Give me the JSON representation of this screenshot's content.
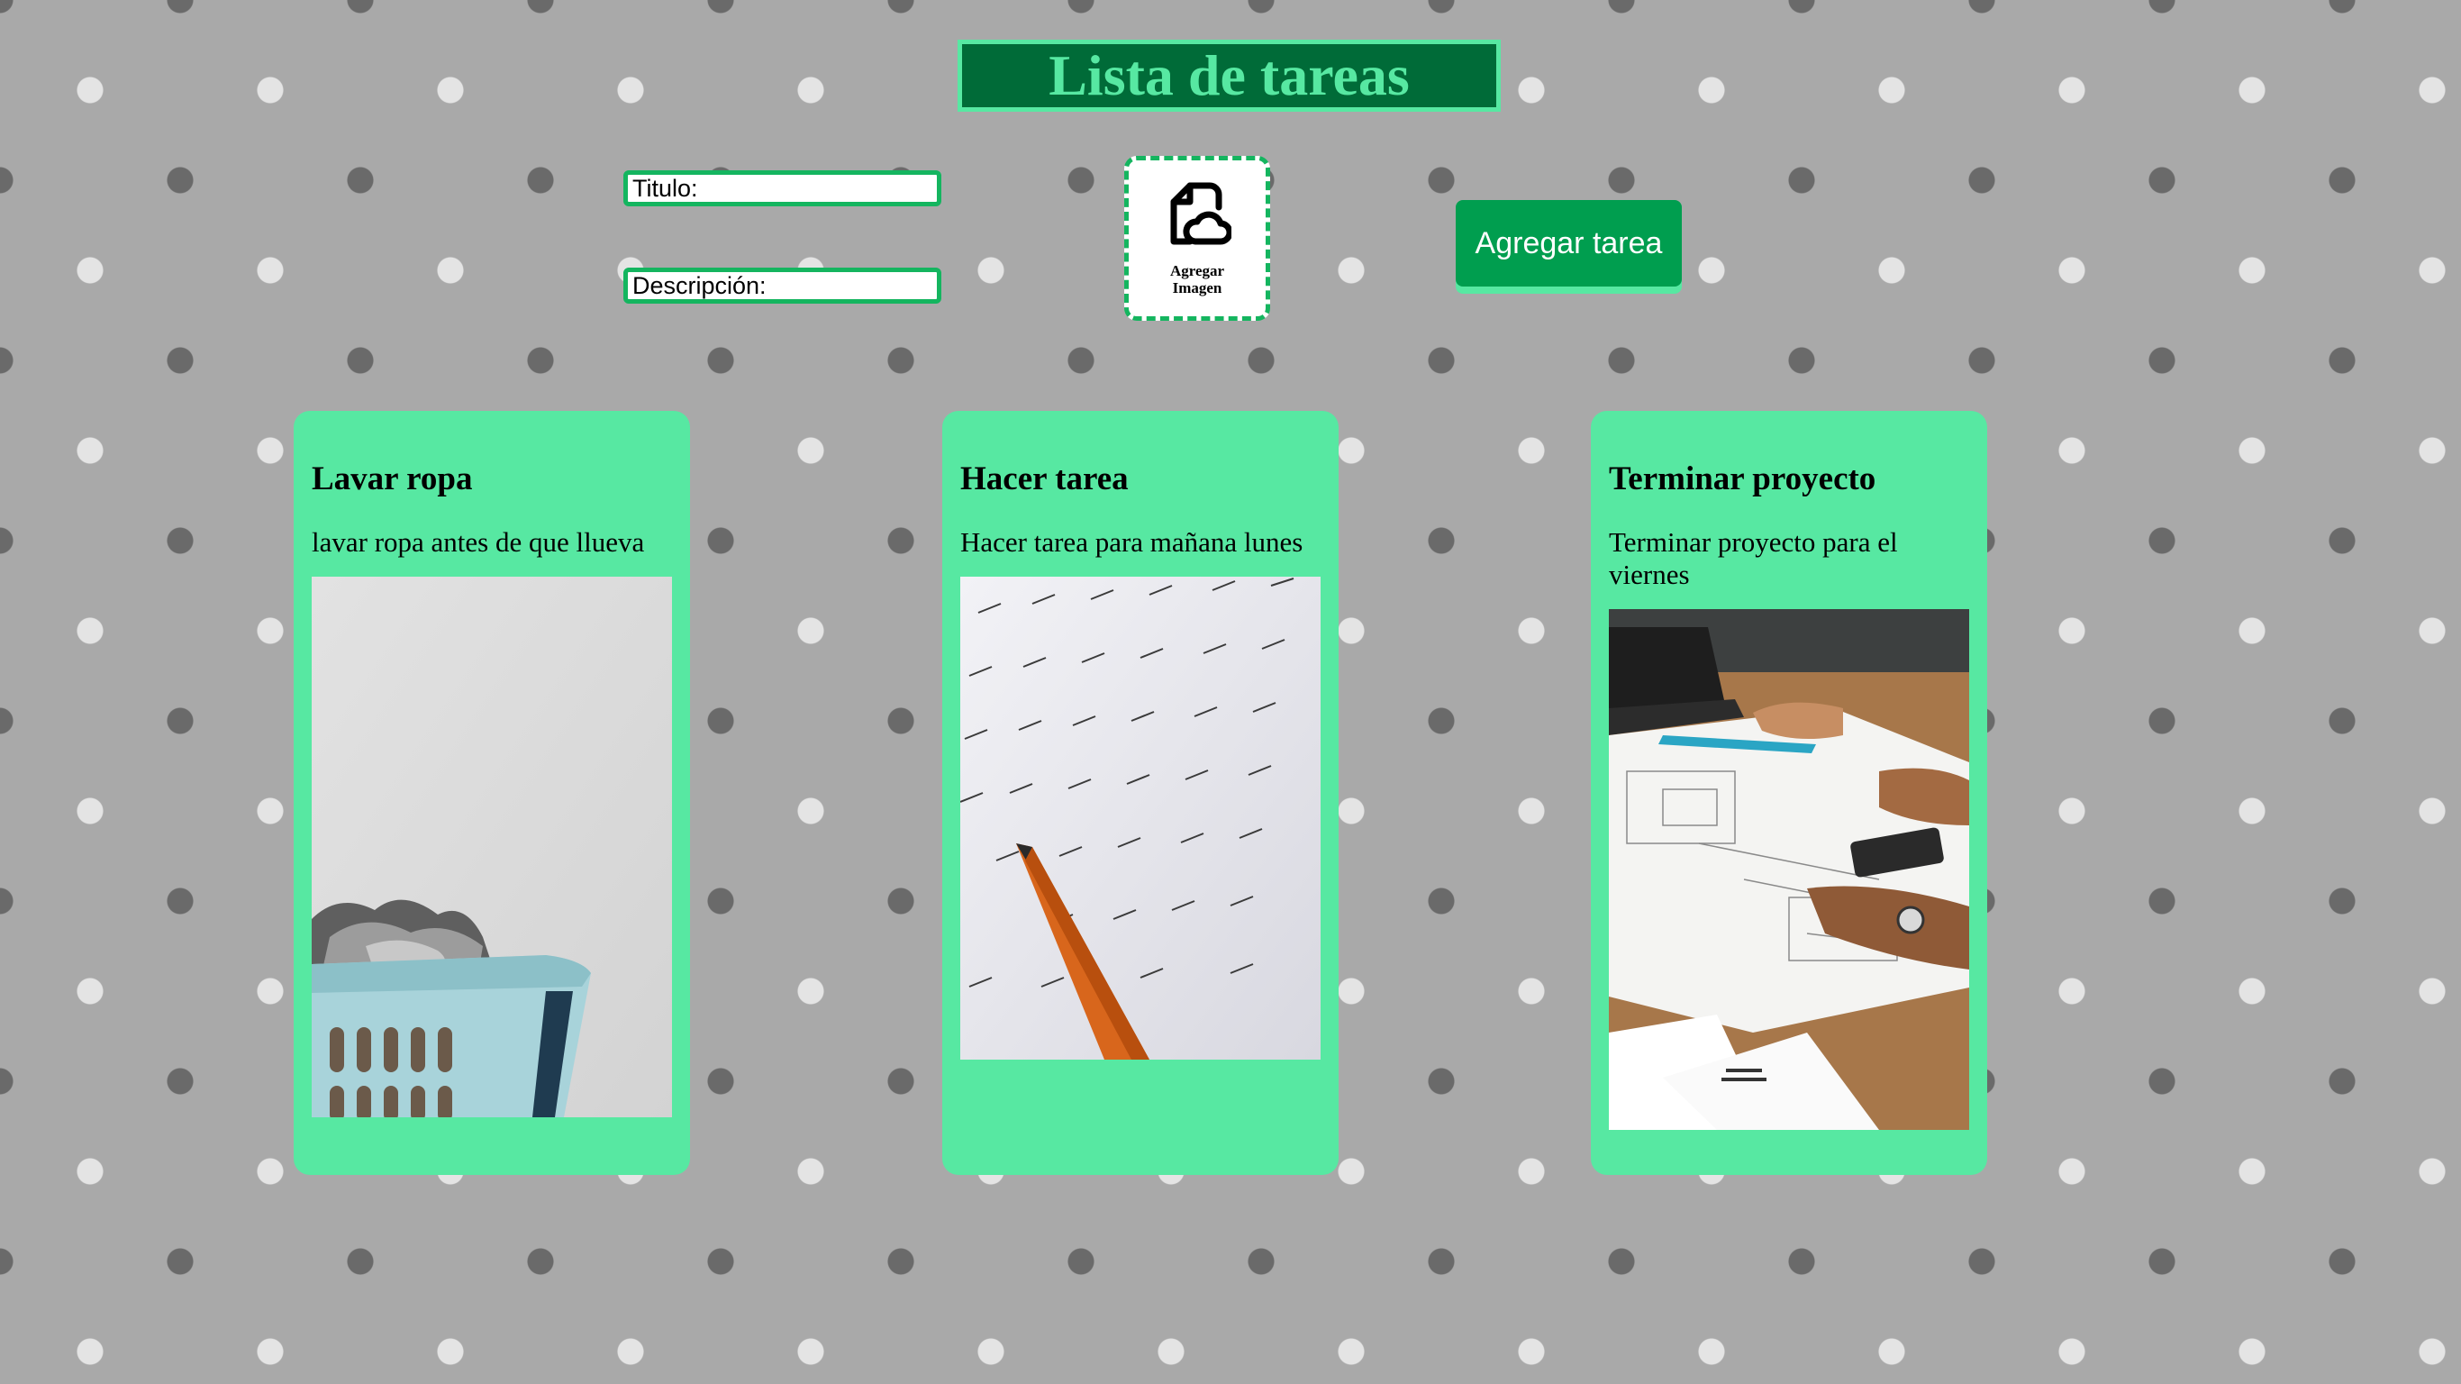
{
  "header": {
    "title": "Lista de tareas"
  },
  "form": {
    "title_placeholder": "Titulo:",
    "title_value": "",
    "description_placeholder": "Descripción:",
    "description_value": "",
    "image_picker": {
      "icon": "file-cloud-upload-icon",
      "label": "Agregar Imagen"
    },
    "submit_label": "Agregar tarea"
  },
  "tasks": [
    {
      "title": "Lavar ropa",
      "description": "lavar ropa antes de que llueva",
      "image": "laundry-basket-photo"
    },
    {
      "title": "Hacer tarea",
      "description": "Hacer tarea para mañana lunes",
      "image": "math-worksheet-pencil-photo"
    },
    {
      "title": "Terminar proyecto",
      "description": "Terminar proyecto para el viernes",
      "image": "architecture-blueprints-photo"
    }
  ],
  "colors": {
    "background": "#a9a9a9",
    "accent": "#57e8a2",
    "header_bg": "#006b38",
    "button_bg": "#009e4f",
    "input_border": "#14b55f"
  }
}
